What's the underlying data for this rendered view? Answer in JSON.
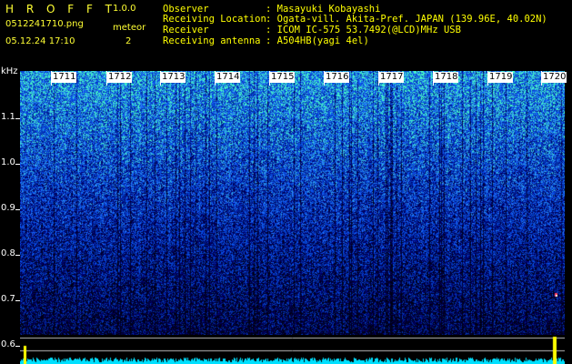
{
  "header": {
    "app_title": "H R O F F T",
    "version": "1.0.0",
    "filename": "0512241710.png",
    "datetime": "05.12.24 17:10",
    "meteor_label": "meteor",
    "meteor_count": "2"
  },
  "info": {
    "observer_label": "Observer",
    "observer_value": ": Masayuki Kobayashi",
    "location_label": "Receiving Location",
    "location_value": ": Ogata-vill. Akita-Pref. JAPAN (139.96E, 40.02N)",
    "receiver_label": "Receiver",
    "receiver_value": ": ICOM IC-575 53.7492(@LCD)MHz USB",
    "antenna_label": "Receiving antenna",
    "antenna_value": ": A504HB(yagi 4el)"
  },
  "axis": {
    "unit": "kHz",
    "labels": [
      "1.1",
      "1.0",
      "0.9",
      "0.8",
      "0.7",
      "0.6"
    ]
  },
  "time_labels": [
    "1711",
    "1712",
    "1713",
    "1714",
    "1715",
    "1716",
    "1717",
    "1718",
    "1719",
    "1720"
  ],
  "colors": {
    "background": "#000000",
    "header_yellow": "#ffff33",
    "info_yellow": "#ffff00",
    "spectrum_low": "#000064",
    "spectrum_mid": "#1e3cff",
    "spectrum_high": "#3cffc8",
    "level_cyan": "#00e0ff"
  }
}
